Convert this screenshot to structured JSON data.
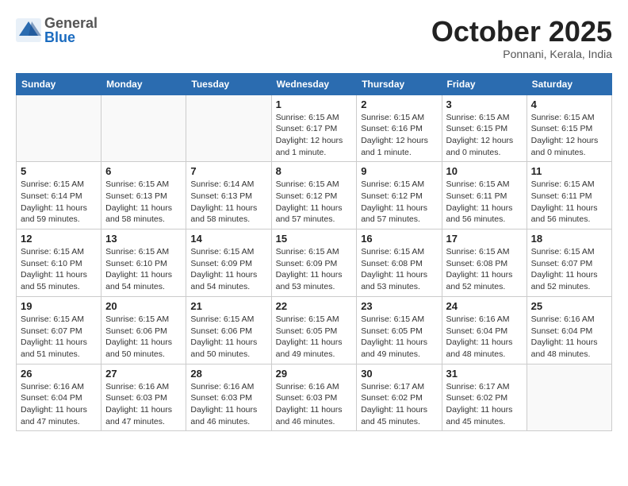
{
  "header": {
    "logo_general": "General",
    "logo_blue": "Blue",
    "month_title": "October 2025",
    "location": "Ponnani, Kerala, India"
  },
  "weekdays": [
    "Sunday",
    "Monday",
    "Tuesday",
    "Wednesday",
    "Thursday",
    "Friday",
    "Saturday"
  ],
  "weeks": [
    [
      {
        "day": "",
        "info": ""
      },
      {
        "day": "",
        "info": ""
      },
      {
        "day": "",
        "info": ""
      },
      {
        "day": "1",
        "info": "Sunrise: 6:15 AM\nSunset: 6:17 PM\nDaylight: 12 hours\nand 1 minute."
      },
      {
        "day": "2",
        "info": "Sunrise: 6:15 AM\nSunset: 6:16 PM\nDaylight: 12 hours\nand 1 minute."
      },
      {
        "day": "3",
        "info": "Sunrise: 6:15 AM\nSunset: 6:15 PM\nDaylight: 12 hours\nand 0 minutes."
      },
      {
        "day": "4",
        "info": "Sunrise: 6:15 AM\nSunset: 6:15 PM\nDaylight: 12 hours\nand 0 minutes."
      }
    ],
    [
      {
        "day": "5",
        "info": "Sunrise: 6:15 AM\nSunset: 6:14 PM\nDaylight: 11 hours\nand 59 minutes."
      },
      {
        "day": "6",
        "info": "Sunrise: 6:15 AM\nSunset: 6:13 PM\nDaylight: 11 hours\nand 58 minutes."
      },
      {
        "day": "7",
        "info": "Sunrise: 6:14 AM\nSunset: 6:13 PM\nDaylight: 11 hours\nand 58 minutes."
      },
      {
        "day": "8",
        "info": "Sunrise: 6:15 AM\nSunset: 6:12 PM\nDaylight: 11 hours\nand 57 minutes."
      },
      {
        "day": "9",
        "info": "Sunrise: 6:15 AM\nSunset: 6:12 PM\nDaylight: 11 hours\nand 57 minutes."
      },
      {
        "day": "10",
        "info": "Sunrise: 6:15 AM\nSunset: 6:11 PM\nDaylight: 11 hours\nand 56 minutes."
      },
      {
        "day": "11",
        "info": "Sunrise: 6:15 AM\nSunset: 6:11 PM\nDaylight: 11 hours\nand 56 minutes."
      }
    ],
    [
      {
        "day": "12",
        "info": "Sunrise: 6:15 AM\nSunset: 6:10 PM\nDaylight: 11 hours\nand 55 minutes."
      },
      {
        "day": "13",
        "info": "Sunrise: 6:15 AM\nSunset: 6:10 PM\nDaylight: 11 hours\nand 54 minutes."
      },
      {
        "day": "14",
        "info": "Sunrise: 6:15 AM\nSunset: 6:09 PM\nDaylight: 11 hours\nand 54 minutes."
      },
      {
        "day": "15",
        "info": "Sunrise: 6:15 AM\nSunset: 6:09 PM\nDaylight: 11 hours\nand 53 minutes."
      },
      {
        "day": "16",
        "info": "Sunrise: 6:15 AM\nSunset: 6:08 PM\nDaylight: 11 hours\nand 53 minutes."
      },
      {
        "day": "17",
        "info": "Sunrise: 6:15 AM\nSunset: 6:08 PM\nDaylight: 11 hours\nand 52 minutes."
      },
      {
        "day": "18",
        "info": "Sunrise: 6:15 AM\nSunset: 6:07 PM\nDaylight: 11 hours\nand 52 minutes."
      }
    ],
    [
      {
        "day": "19",
        "info": "Sunrise: 6:15 AM\nSunset: 6:07 PM\nDaylight: 11 hours\nand 51 minutes."
      },
      {
        "day": "20",
        "info": "Sunrise: 6:15 AM\nSunset: 6:06 PM\nDaylight: 11 hours\nand 50 minutes."
      },
      {
        "day": "21",
        "info": "Sunrise: 6:15 AM\nSunset: 6:06 PM\nDaylight: 11 hours\nand 50 minutes."
      },
      {
        "day": "22",
        "info": "Sunrise: 6:15 AM\nSunset: 6:05 PM\nDaylight: 11 hours\nand 49 minutes."
      },
      {
        "day": "23",
        "info": "Sunrise: 6:15 AM\nSunset: 6:05 PM\nDaylight: 11 hours\nand 49 minutes."
      },
      {
        "day": "24",
        "info": "Sunrise: 6:16 AM\nSunset: 6:04 PM\nDaylight: 11 hours\nand 48 minutes."
      },
      {
        "day": "25",
        "info": "Sunrise: 6:16 AM\nSunset: 6:04 PM\nDaylight: 11 hours\nand 48 minutes."
      }
    ],
    [
      {
        "day": "26",
        "info": "Sunrise: 6:16 AM\nSunset: 6:04 PM\nDaylight: 11 hours\nand 47 minutes."
      },
      {
        "day": "27",
        "info": "Sunrise: 6:16 AM\nSunset: 6:03 PM\nDaylight: 11 hours\nand 47 minutes."
      },
      {
        "day": "28",
        "info": "Sunrise: 6:16 AM\nSunset: 6:03 PM\nDaylight: 11 hours\nand 46 minutes."
      },
      {
        "day": "29",
        "info": "Sunrise: 6:16 AM\nSunset: 6:03 PM\nDaylight: 11 hours\nand 46 minutes."
      },
      {
        "day": "30",
        "info": "Sunrise: 6:17 AM\nSunset: 6:02 PM\nDaylight: 11 hours\nand 45 minutes."
      },
      {
        "day": "31",
        "info": "Sunrise: 6:17 AM\nSunset: 6:02 PM\nDaylight: 11 hours\nand 45 minutes."
      },
      {
        "day": "",
        "info": ""
      }
    ]
  ]
}
